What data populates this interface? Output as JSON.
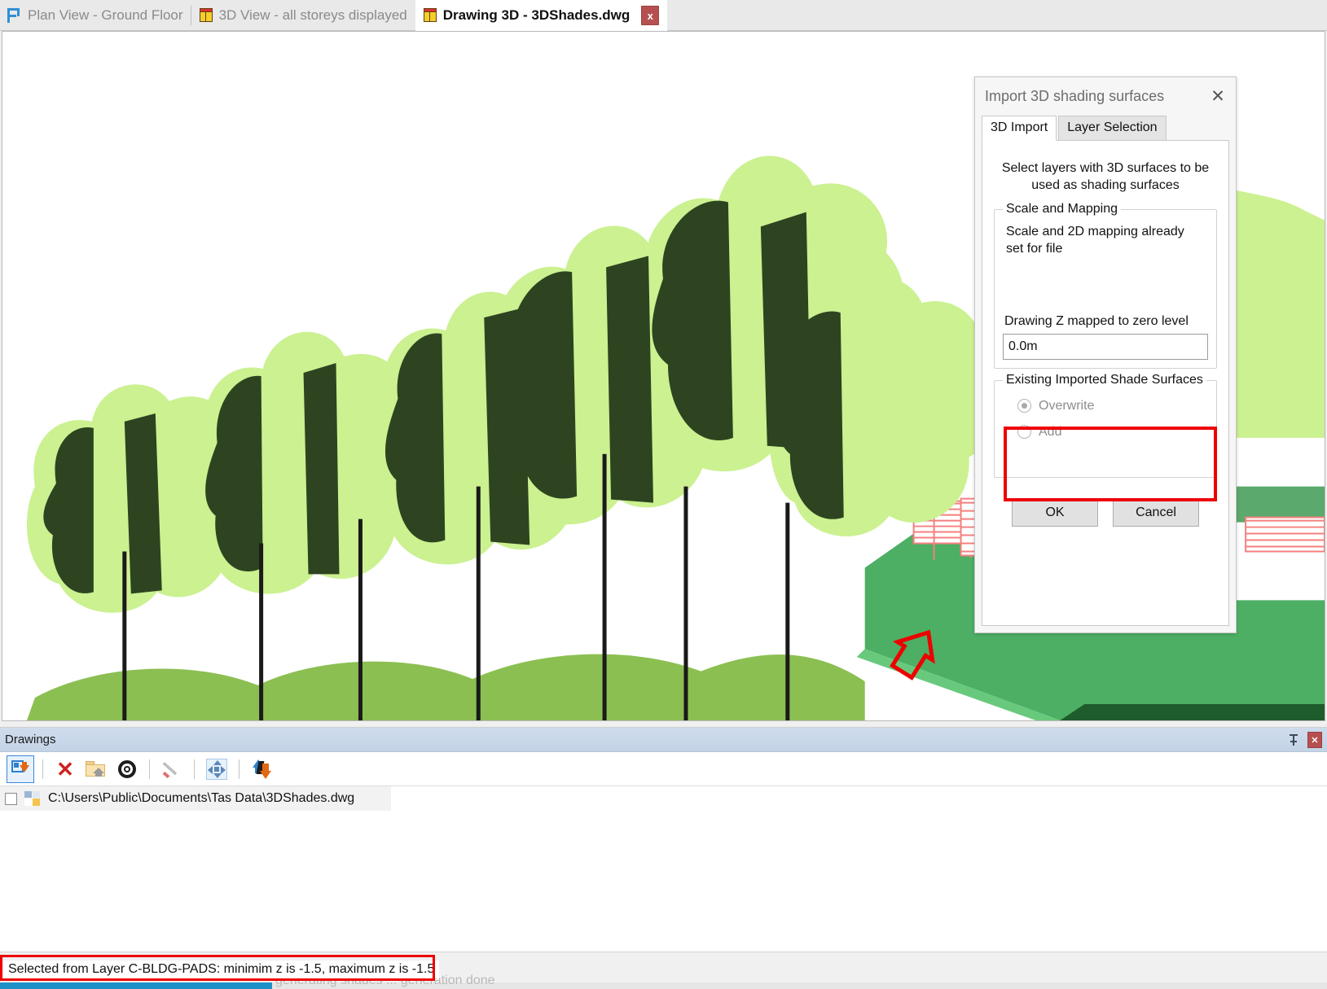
{
  "tabs": [
    {
      "label": "Plan View - Ground Floor",
      "icon": "plan-view-icon",
      "active": false,
      "closable": false
    },
    {
      "label": "3D View - all storeys displayed",
      "icon": "3d-box-icon",
      "active": false,
      "closable": false
    },
    {
      "label": "Drawing 3D - 3DShades.dwg",
      "icon": "3d-box-icon",
      "active": true,
      "closable": true,
      "close_label": "x"
    }
  ],
  "dialog": {
    "title": "Import 3D shading surfaces",
    "close_label": "✕",
    "tabs": [
      {
        "label": "3D Import",
        "active": true
      },
      {
        "label": "Layer Selection",
        "active": false
      }
    ],
    "intro": "Select layers with 3D surfaces to be used as shading surfaces",
    "scale_group": {
      "legend": "Scale and Mapping",
      "note": "Scale and 2D mapping already set for file",
      "z_label": "Drawing Z mapped to zero level",
      "z_value": "0.0m"
    },
    "existing_group": {
      "legend": "Existing Imported Shade Surfaces",
      "options": [
        {
          "label": "Overwrite",
          "selected": true
        },
        {
          "label": "Add",
          "selected": false
        }
      ]
    },
    "buttons": {
      "ok": "OK",
      "cancel": "Cancel"
    }
  },
  "dock": {
    "title": "Drawings",
    "pin_icon": "pin-icon",
    "close_label": "✕",
    "toolbar": [
      {
        "name": "import-drawing-button",
        "icon": "import-drawing-icon",
        "framed": true
      },
      {
        "name": "delete-drawing-button",
        "icon": "delete-x-icon",
        "framed": false
      },
      {
        "name": "open-folder-button",
        "icon": "folder-home-icon",
        "framed": false
      },
      {
        "name": "settings-button",
        "icon": "gear-icon",
        "framed": false
      },
      {
        "name": "draw-tool-button",
        "icon": "brush-icon",
        "framed": false
      },
      {
        "name": "move-button",
        "icon": "move-arrows-icon",
        "framed": false
      },
      {
        "name": "reorder-button",
        "icon": "up-down-arrows-icon",
        "framed": false
      }
    ],
    "rows": [
      {
        "checked": false,
        "icon": "dwg-file-icon",
        "path": "C:\\Users\\Public\\Documents\\Tas Data\\3DShades.dwg"
      }
    ]
  },
  "status": {
    "message": "Selected from Layer C-BLDG-PADS: minimim z is -1.5, maximum z is -1.5",
    "ghost_message": "generating shades ... generation done"
  },
  "colors": {
    "leaf_light": "#cbf191",
    "leaf_dark": "#2e4420",
    "ground_shadow": "#8cbf52",
    "pad_green": "#4caf64",
    "pad_edge": "#1e5c2c",
    "building_red": "#f4807f",
    "annotation_red": "#ee0000",
    "dock_header": "#c8d7e9",
    "accent_blue": "#2f7fd0"
  }
}
